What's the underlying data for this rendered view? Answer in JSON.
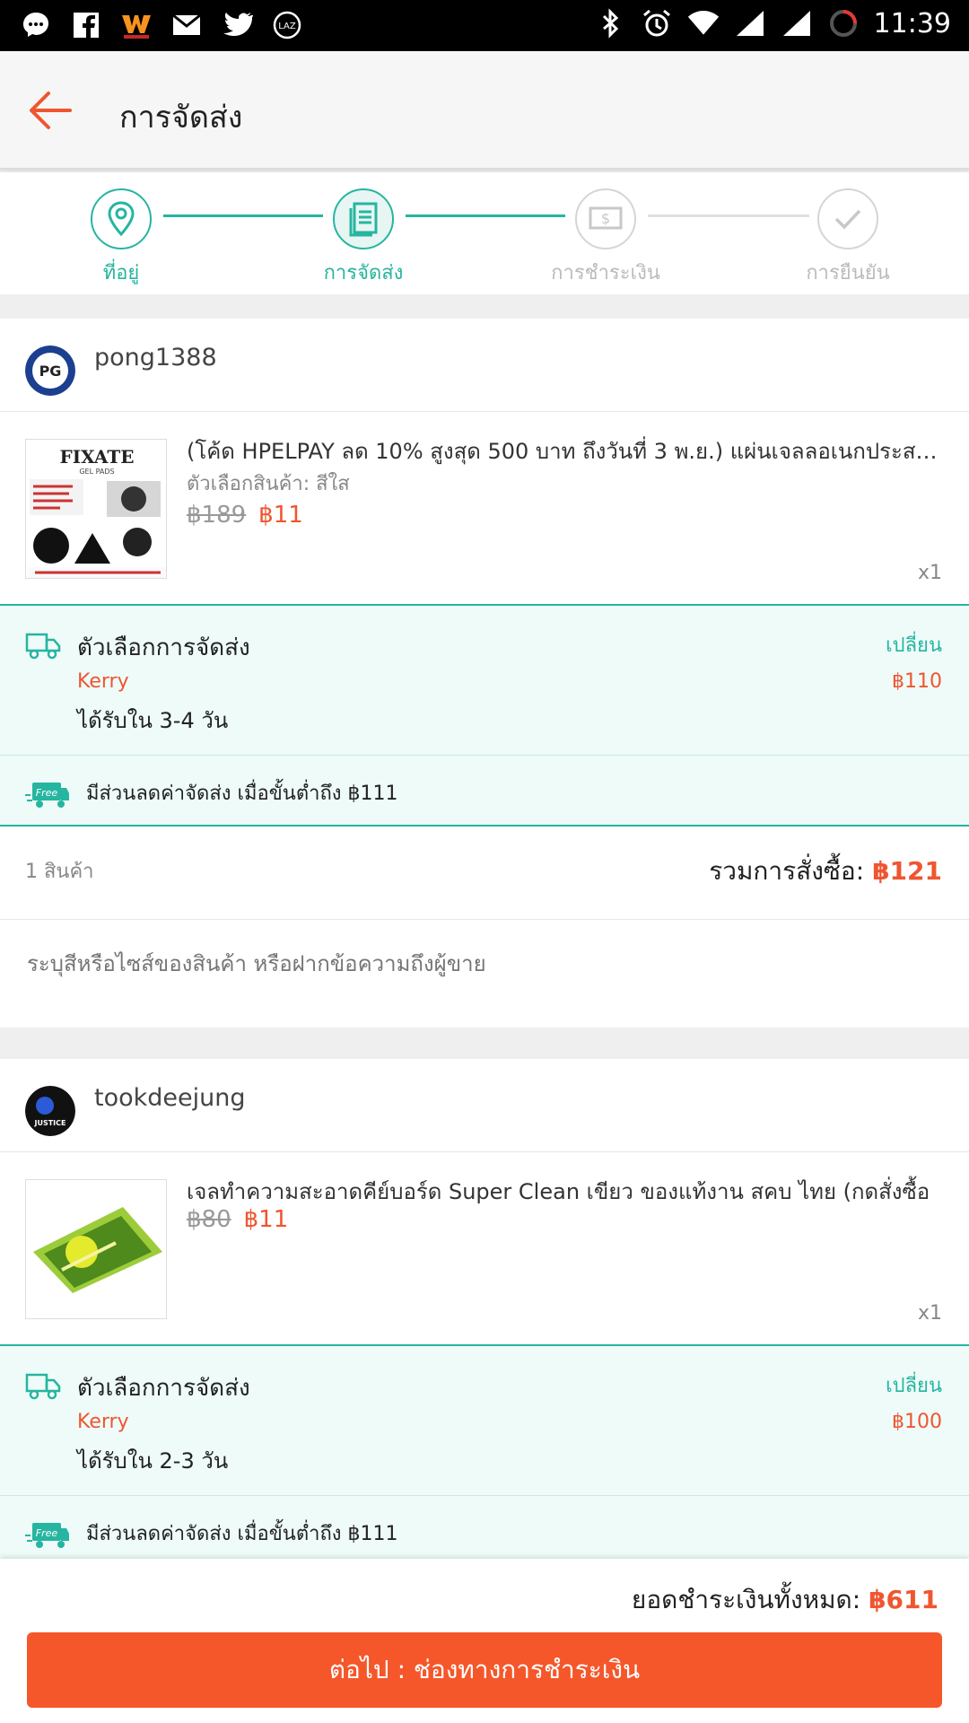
{
  "status_bar": {
    "time": "11:39",
    "left_icons": [
      "messenger-icon",
      "facebook-icon",
      "truemoney-icon",
      "gmail-icon",
      "twitter-icon",
      "lazada-icon"
    ],
    "right_icons": [
      "bluetooth-icon",
      "alarm-icon",
      "wifi-icon",
      "signal-icon",
      "signal-icon",
      "loading-icon"
    ]
  },
  "header": {
    "title": "การจัดส่ง"
  },
  "stepper": {
    "steps": [
      {
        "label": "ที่อยู่",
        "state": "done"
      },
      {
        "label": "การจัดส่ง",
        "state": "current"
      },
      {
        "label": "การชำระเงิน",
        "state": "pending"
      },
      {
        "label": "การยืนยัน",
        "state": "pending"
      }
    ]
  },
  "orders": [
    {
      "shop_name": "pong1388",
      "avatar_text": "PG",
      "product": {
        "title": "(โค้ด HPELPAY ลด 10% สูงสุด 500 บาท ถึงวันที่ 3 พ.ย.) แผ่นเจลลอเนกประสงค์",
        "variant": "ตัวเลือกสินค้า: สีใส",
        "old_price": "฿189",
        "new_price": "฿11",
        "qty": "x1",
        "thumb_brand": "FIXATE",
        "thumb_sub": "GEL PADS"
      },
      "shipping": {
        "title": "ตัวเลือกการจัดส่ง",
        "change": "เปลี่ยน",
        "carrier": "Kerry",
        "price": "฿110",
        "eta": "ได้รับใน 3-4 วัน"
      },
      "promo": {
        "badge": "Free",
        "text": "มีส่วนลดค่าจัดส่ง เมื่อขั้นต่ำถึง ฿111"
      },
      "subtotal": {
        "count": "1 สินค้า",
        "label": "รวมการสั่งซื้อ: ",
        "amount": "฿121"
      },
      "note_placeholder": "ระบุสีหรือไซส์ของสินค้า หรือฝากข้อความถึงผู้ขาย"
    },
    {
      "shop_name": "tookdeejung",
      "avatar_text": "JUSTICE",
      "product": {
        "title": "เจลทำความสะอาดคีย์บอร์ด Super Clean เขียว ของแท้งาน สคบ ไทย (กดสั่งซื้อ",
        "old_price": "฿80",
        "new_price": "฿11",
        "qty": "x1"
      },
      "shipping": {
        "title": "ตัวเลือกการจัดส่ง",
        "change": "เปลี่ยน",
        "carrier": "Kerry",
        "price": "฿100",
        "eta": "ได้รับใน 2-3 วัน"
      },
      "promo": {
        "badge": "Free",
        "text": "มีส่วนลดค่าจัดส่ง เมื่อขั้นต่ำถึง ฿111"
      }
    }
  ],
  "footer": {
    "total_label": "ยอดชำระเงินทั้งหมด: ",
    "total_amount": "฿611",
    "cta": "ต่อไป : ช่องทางการชำระเงิน"
  },
  "colors": {
    "accent": "#26b5a0",
    "price": "#ef5630",
    "cta": "#f5572a"
  }
}
